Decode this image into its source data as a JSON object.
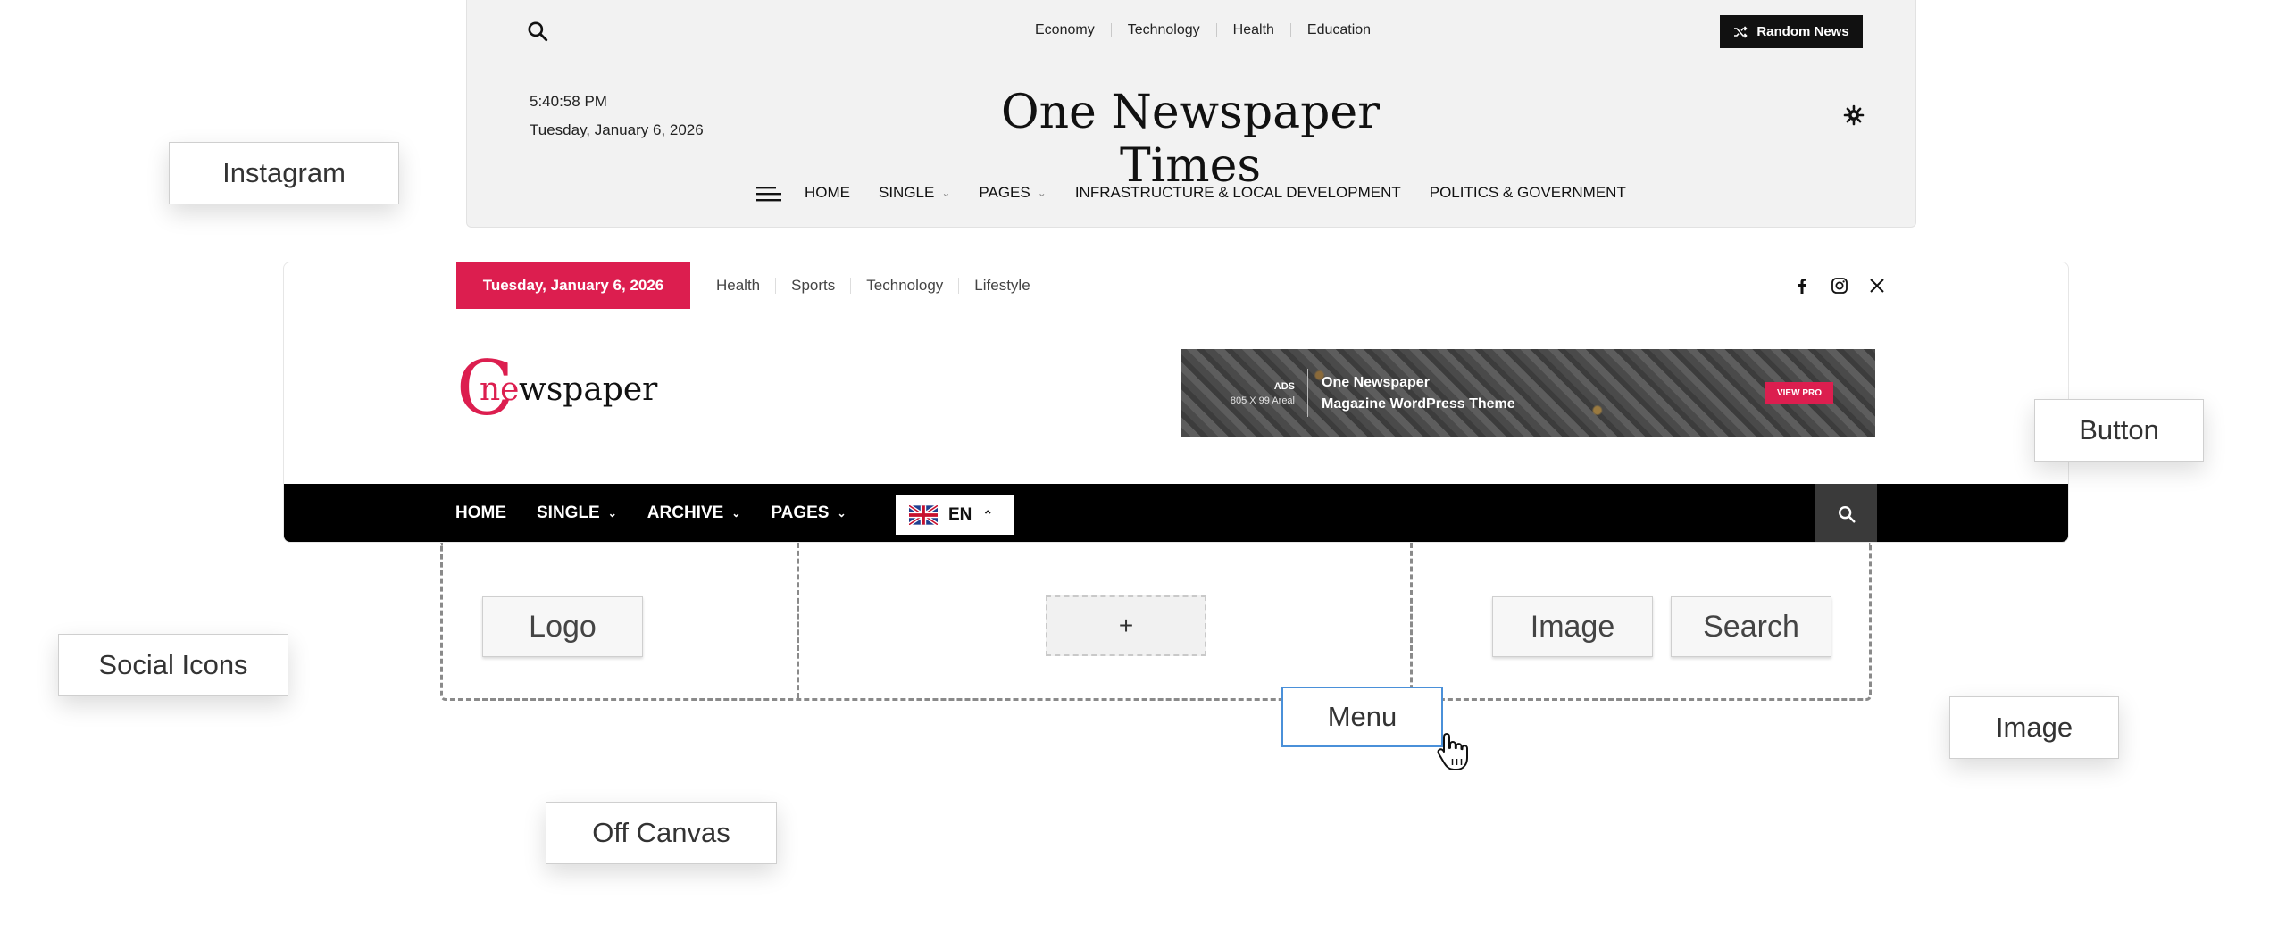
{
  "header_top": {
    "top_links": [
      "Economy",
      "Technology",
      "Health",
      "Education"
    ],
    "random_button": "Random News",
    "time": "5:40:58 PM",
    "date": "Tuesday, January 6, 2026",
    "site_title": "One Newspaper Times",
    "nav": [
      {
        "label": "HOME",
        "dropdown": false
      },
      {
        "label": "SINGLE",
        "dropdown": true
      },
      {
        "label": "PAGES",
        "dropdown": true
      },
      {
        "label": "INFRASTRUCTURE & LOCAL DEVELOPMENT",
        "dropdown": false
      },
      {
        "label": "POLITICS & GOVERNMENT",
        "dropdown": false
      }
    ]
  },
  "header_second": {
    "date_badge": "Tuesday, January 6, 2026",
    "categories": [
      "Health",
      "Sports",
      "Technology",
      "Lifestyle"
    ],
    "social_icons": [
      "facebook-icon",
      "instagram-icon",
      "x-icon"
    ],
    "logo": {
      "mark": "ne",
      "text": "wspaper"
    },
    "ad": {
      "label_line1": "ADS",
      "label_line2": "805 X 99 Areal",
      "line1": "One Newspaper",
      "line2": "Magazine WordPress Theme",
      "button": "VIEW PRO"
    },
    "nav": [
      {
        "label": "HOME",
        "dropdown": false
      },
      {
        "label": "SINGLE",
        "dropdown": true
      },
      {
        "label": "ARCHIVE",
        "dropdown": true
      },
      {
        "label": "PAGES",
        "dropdown": true
      }
    ],
    "language": "EN"
  },
  "builder": {
    "chips": {
      "logo": "Logo",
      "add": "+",
      "image": "Image",
      "search": "Search"
    }
  },
  "floating_labels": {
    "instagram": "Instagram",
    "button": "Button",
    "social_icons": "Social Icons",
    "menu": "Menu",
    "image": "Image",
    "off_canvas": "Off Canvas"
  },
  "colors": {
    "accent": "#dc1e4f",
    "nav_bg": "#000000",
    "header_bg": "#f2f2f2",
    "selected_outline": "#4a90d9"
  }
}
